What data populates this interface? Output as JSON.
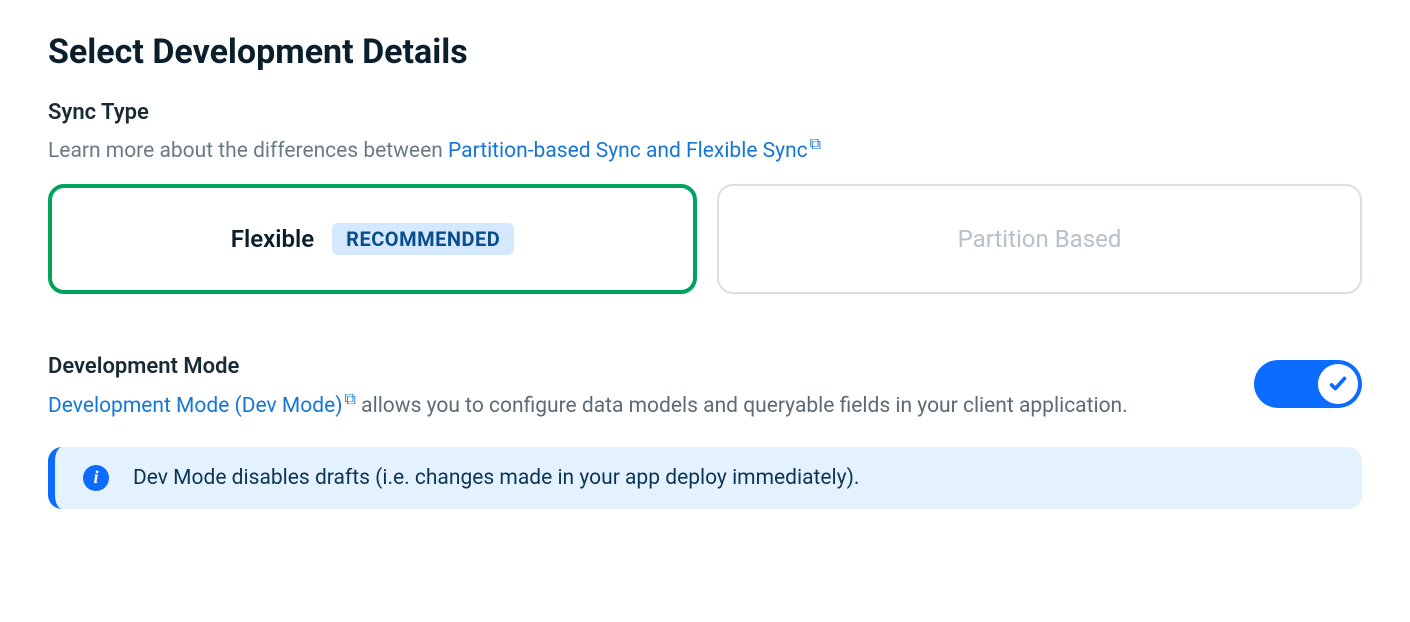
{
  "heading": "Select Development Details",
  "sync": {
    "label": "Sync Type",
    "helper_prefix": "Learn more about the differences between ",
    "link_text": "Partition-based Sync and Flexible Sync",
    "options": {
      "flexible": {
        "label": "Flexible",
        "badge": "RECOMMENDED"
      },
      "partition": {
        "label": "Partition Based"
      }
    }
  },
  "devmode": {
    "label": "Development Mode",
    "link_text": "Development Mode (Dev Mode)",
    "desc_tail": " allows you to configure data models and queryable fields in your client application.",
    "toggle_on": true
  },
  "banner": {
    "text": "Dev Mode disables drafts (i.e. changes made in your app deploy immediately)."
  }
}
